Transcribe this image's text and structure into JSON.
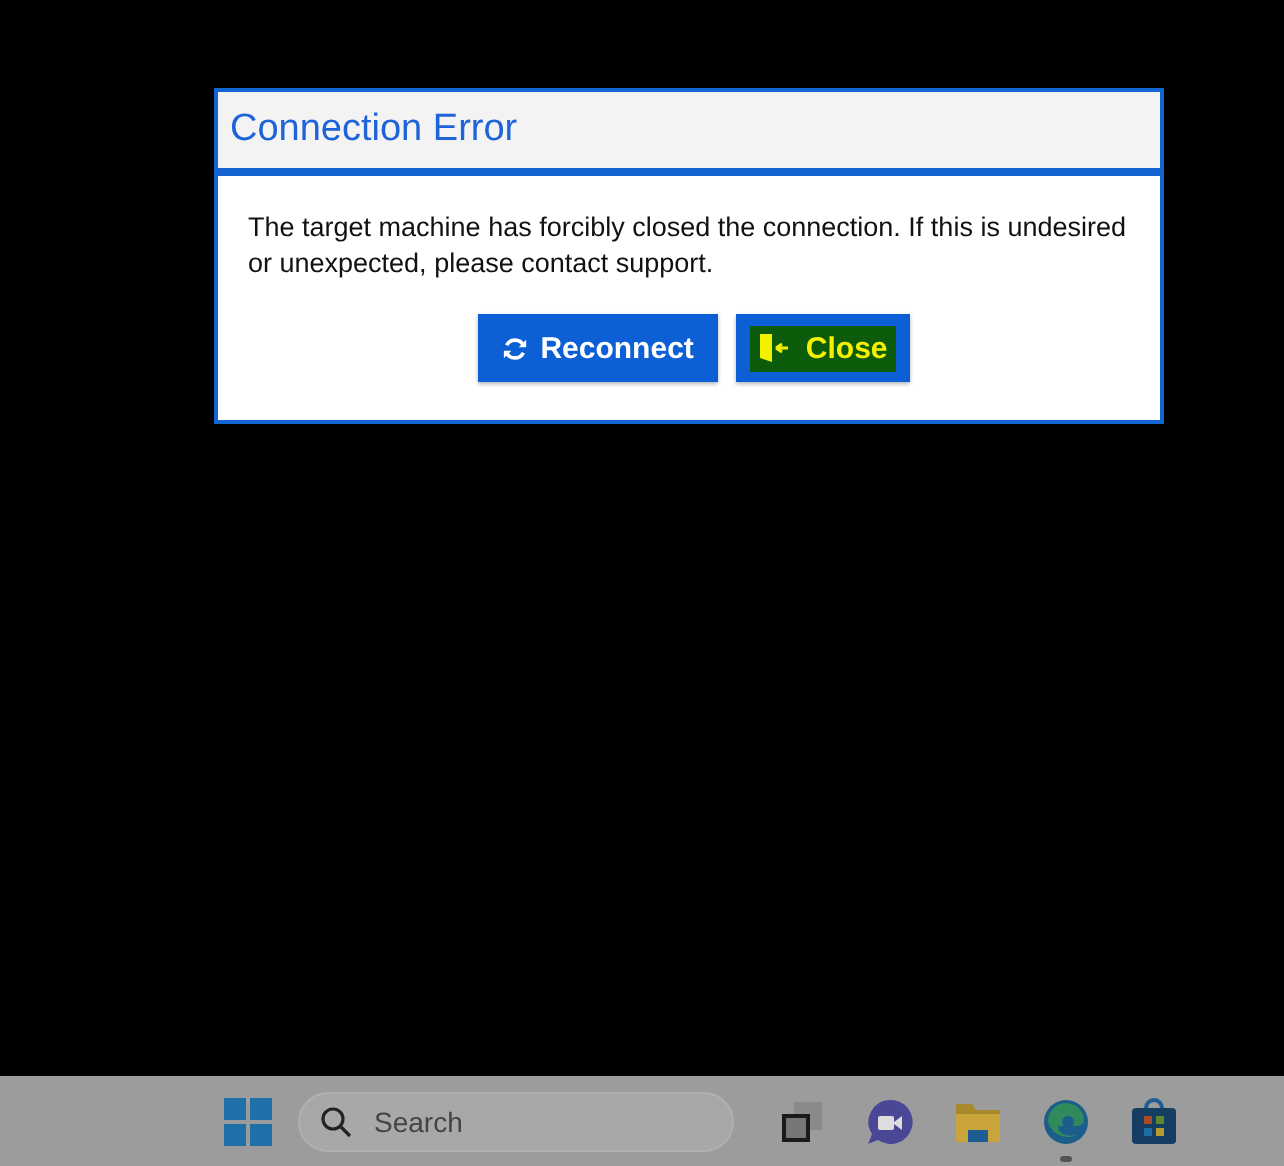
{
  "dialog": {
    "title": "Connection Error",
    "message": "The target machine has forcibly closed the connection. If this is undesired or unexpected, please contact support.",
    "buttons": [
      {
        "label": "Reconnect",
        "kind": "reconnect",
        "highlighted": false
      },
      {
        "label": "Close",
        "kind": "close",
        "highlighted": true
      }
    ]
  },
  "taskbar": {
    "search": {
      "placeholder": "Search"
    },
    "apps": [
      {
        "kind": "taskview",
        "running": false
      },
      {
        "kind": "chat",
        "running": false
      },
      {
        "kind": "folder",
        "running": false
      },
      {
        "kind": "browser",
        "running": true
      },
      {
        "kind": "store",
        "running": false
      }
    ]
  }
}
